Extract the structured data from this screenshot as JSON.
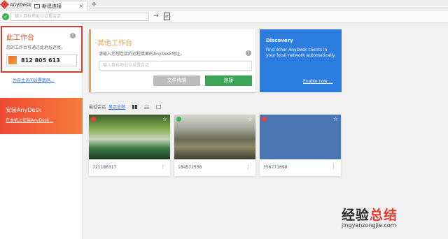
{
  "tabbar": {
    "app_name": "AnyDesk",
    "tab_label": "新建连接",
    "tab_close": "×",
    "new_tab": "+"
  },
  "address": {
    "placeholder": "输入目标地址以设置会话"
  },
  "this_desk": {
    "title": "此工作台",
    "description": "您的工作台可通过此地址连接。",
    "id": "812 805 613"
  },
  "set_password_link": "为自主访问设置密码...",
  "install": {
    "title": "安装AnyDesk",
    "link": "在本机上安装AnyDesk..."
  },
  "remote": {
    "title": "其他工作台",
    "description": "请输入您想连接的远程桌面的AnyDesk地址。",
    "placeholder": "输入目标地址以设置会话",
    "file_button": "文件传输",
    "connect_button": "连接"
  },
  "discovery": {
    "title": "Discovery",
    "description": "Find other AnyDesk clients in your local network automatically.",
    "link": "Enable now ..."
  },
  "recent": {
    "label": "最近会话",
    "show_all": "显示全部"
  },
  "cards": [
    {
      "id": "721186317",
      "status_color": "#e2463a"
    },
    {
      "id": "184572556",
      "status_color": "#3bb24a"
    },
    {
      "id": "356771898",
      "status_color": "#e2463a"
    }
  ],
  "watermark": {
    "text_a": "经验",
    "text_b": "总结",
    "url": "jingyanzongjie.com"
  },
  "colors": {
    "accent": "#e2463a",
    "connect": "#3aa457",
    "discovery": "#2d7ce0"
  }
}
